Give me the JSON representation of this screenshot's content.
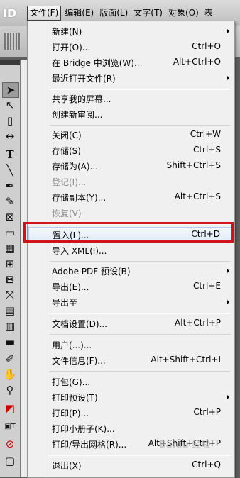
{
  "app": {
    "logo_text": "ID"
  },
  "menubar": [
    "文件(F)",
    "编辑(E)",
    "版面(L)",
    "文字(T)",
    "对象(O)",
    "表"
  ],
  "file_menu": {
    "items": [
      {
        "label": "新建(N)",
        "shortcut": "",
        "submenu": true,
        "disabled": false
      },
      {
        "label": "打开(O)...",
        "shortcut": "Ctrl+O",
        "submenu": false,
        "disabled": false
      },
      {
        "label": "在 Bridge 中浏览(W)...",
        "shortcut": "Alt+Ctrl+O",
        "submenu": false,
        "disabled": false
      },
      {
        "label": "最近打开文件(R)",
        "shortcut": "",
        "submenu": true,
        "disabled": false
      },
      {
        "label": "共享我的屏幕...",
        "shortcut": "",
        "submenu": false,
        "disabled": false
      },
      {
        "label": "创建新审阅...",
        "shortcut": "",
        "submenu": false,
        "disabled": false
      },
      {
        "label": "关闭(C)",
        "shortcut": "Ctrl+W",
        "submenu": false,
        "disabled": false
      },
      {
        "label": "存储(S)",
        "shortcut": "Ctrl+S",
        "submenu": false,
        "disabled": false
      },
      {
        "label": "存储为(A)...",
        "shortcut": "Shift+Ctrl+S",
        "submenu": false,
        "disabled": false
      },
      {
        "label": "登记(I)...",
        "shortcut": "",
        "submenu": false,
        "disabled": true
      },
      {
        "label": "存储副本(Y)...",
        "shortcut": "Alt+Ctrl+S",
        "submenu": false,
        "disabled": false
      },
      {
        "label": "恢复(V)",
        "shortcut": "",
        "submenu": false,
        "disabled": true
      },
      {
        "label": "置入(L)...",
        "shortcut": "Ctrl+D",
        "submenu": false,
        "disabled": false,
        "highlighted": true
      },
      {
        "label": "导入 XML(I)...",
        "shortcut": "",
        "submenu": false,
        "disabled": false
      },
      {
        "label": "Adobe PDF 预设(B)",
        "shortcut": "",
        "submenu": true,
        "disabled": false
      },
      {
        "label": "导出(E)...",
        "shortcut": "Ctrl+E",
        "submenu": false,
        "disabled": false
      },
      {
        "label": "导出至",
        "shortcut": "",
        "submenu": true,
        "disabled": false
      },
      {
        "label": "文档设置(D)...",
        "shortcut": "Alt+Ctrl+P",
        "submenu": false,
        "disabled": false
      },
      {
        "label": "用户(...)...",
        "shortcut": "",
        "submenu": false,
        "disabled": false
      },
      {
        "label": "文件信息(F)...",
        "shortcut": "Alt+Shift+Ctrl+I",
        "submenu": false,
        "disabled": false
      },
      {
        "label": "打包(G)...",
        "shortcut": "",
        "submenu": false,
        "disabled": false
      },
      {
        "label": "打印预设(T)",
        "shortcut": "",
        "submenu": true,
        "disabled": false
      },
      {
        "label": "打印(P)...",
        "shortcut": "Ctrl+P",
        "submenu": false,
        "disabled": false
      },
      {
        "label": "打印小册子(K)...",
        "shortcut": "",
        "submenu": false,
        "disabled": false
      },
      {
        "label": "打印/导出网格(R)...",
        "shortcut": "Alt+Shift+Ctrl+P",
        "submenu": false,
        "disabled": false
      },
      {
        "label": "退出(X)",
        "shortcut": "Ctrl+Q",
        "submenu": false,
        "disabled": false
      }
    ]
  },
  "watermark": "Baidu 经验",
  "colors": {
    "annotation_red": "#d2121a",
    "highlight": "#dfeaf7"
  }
}
